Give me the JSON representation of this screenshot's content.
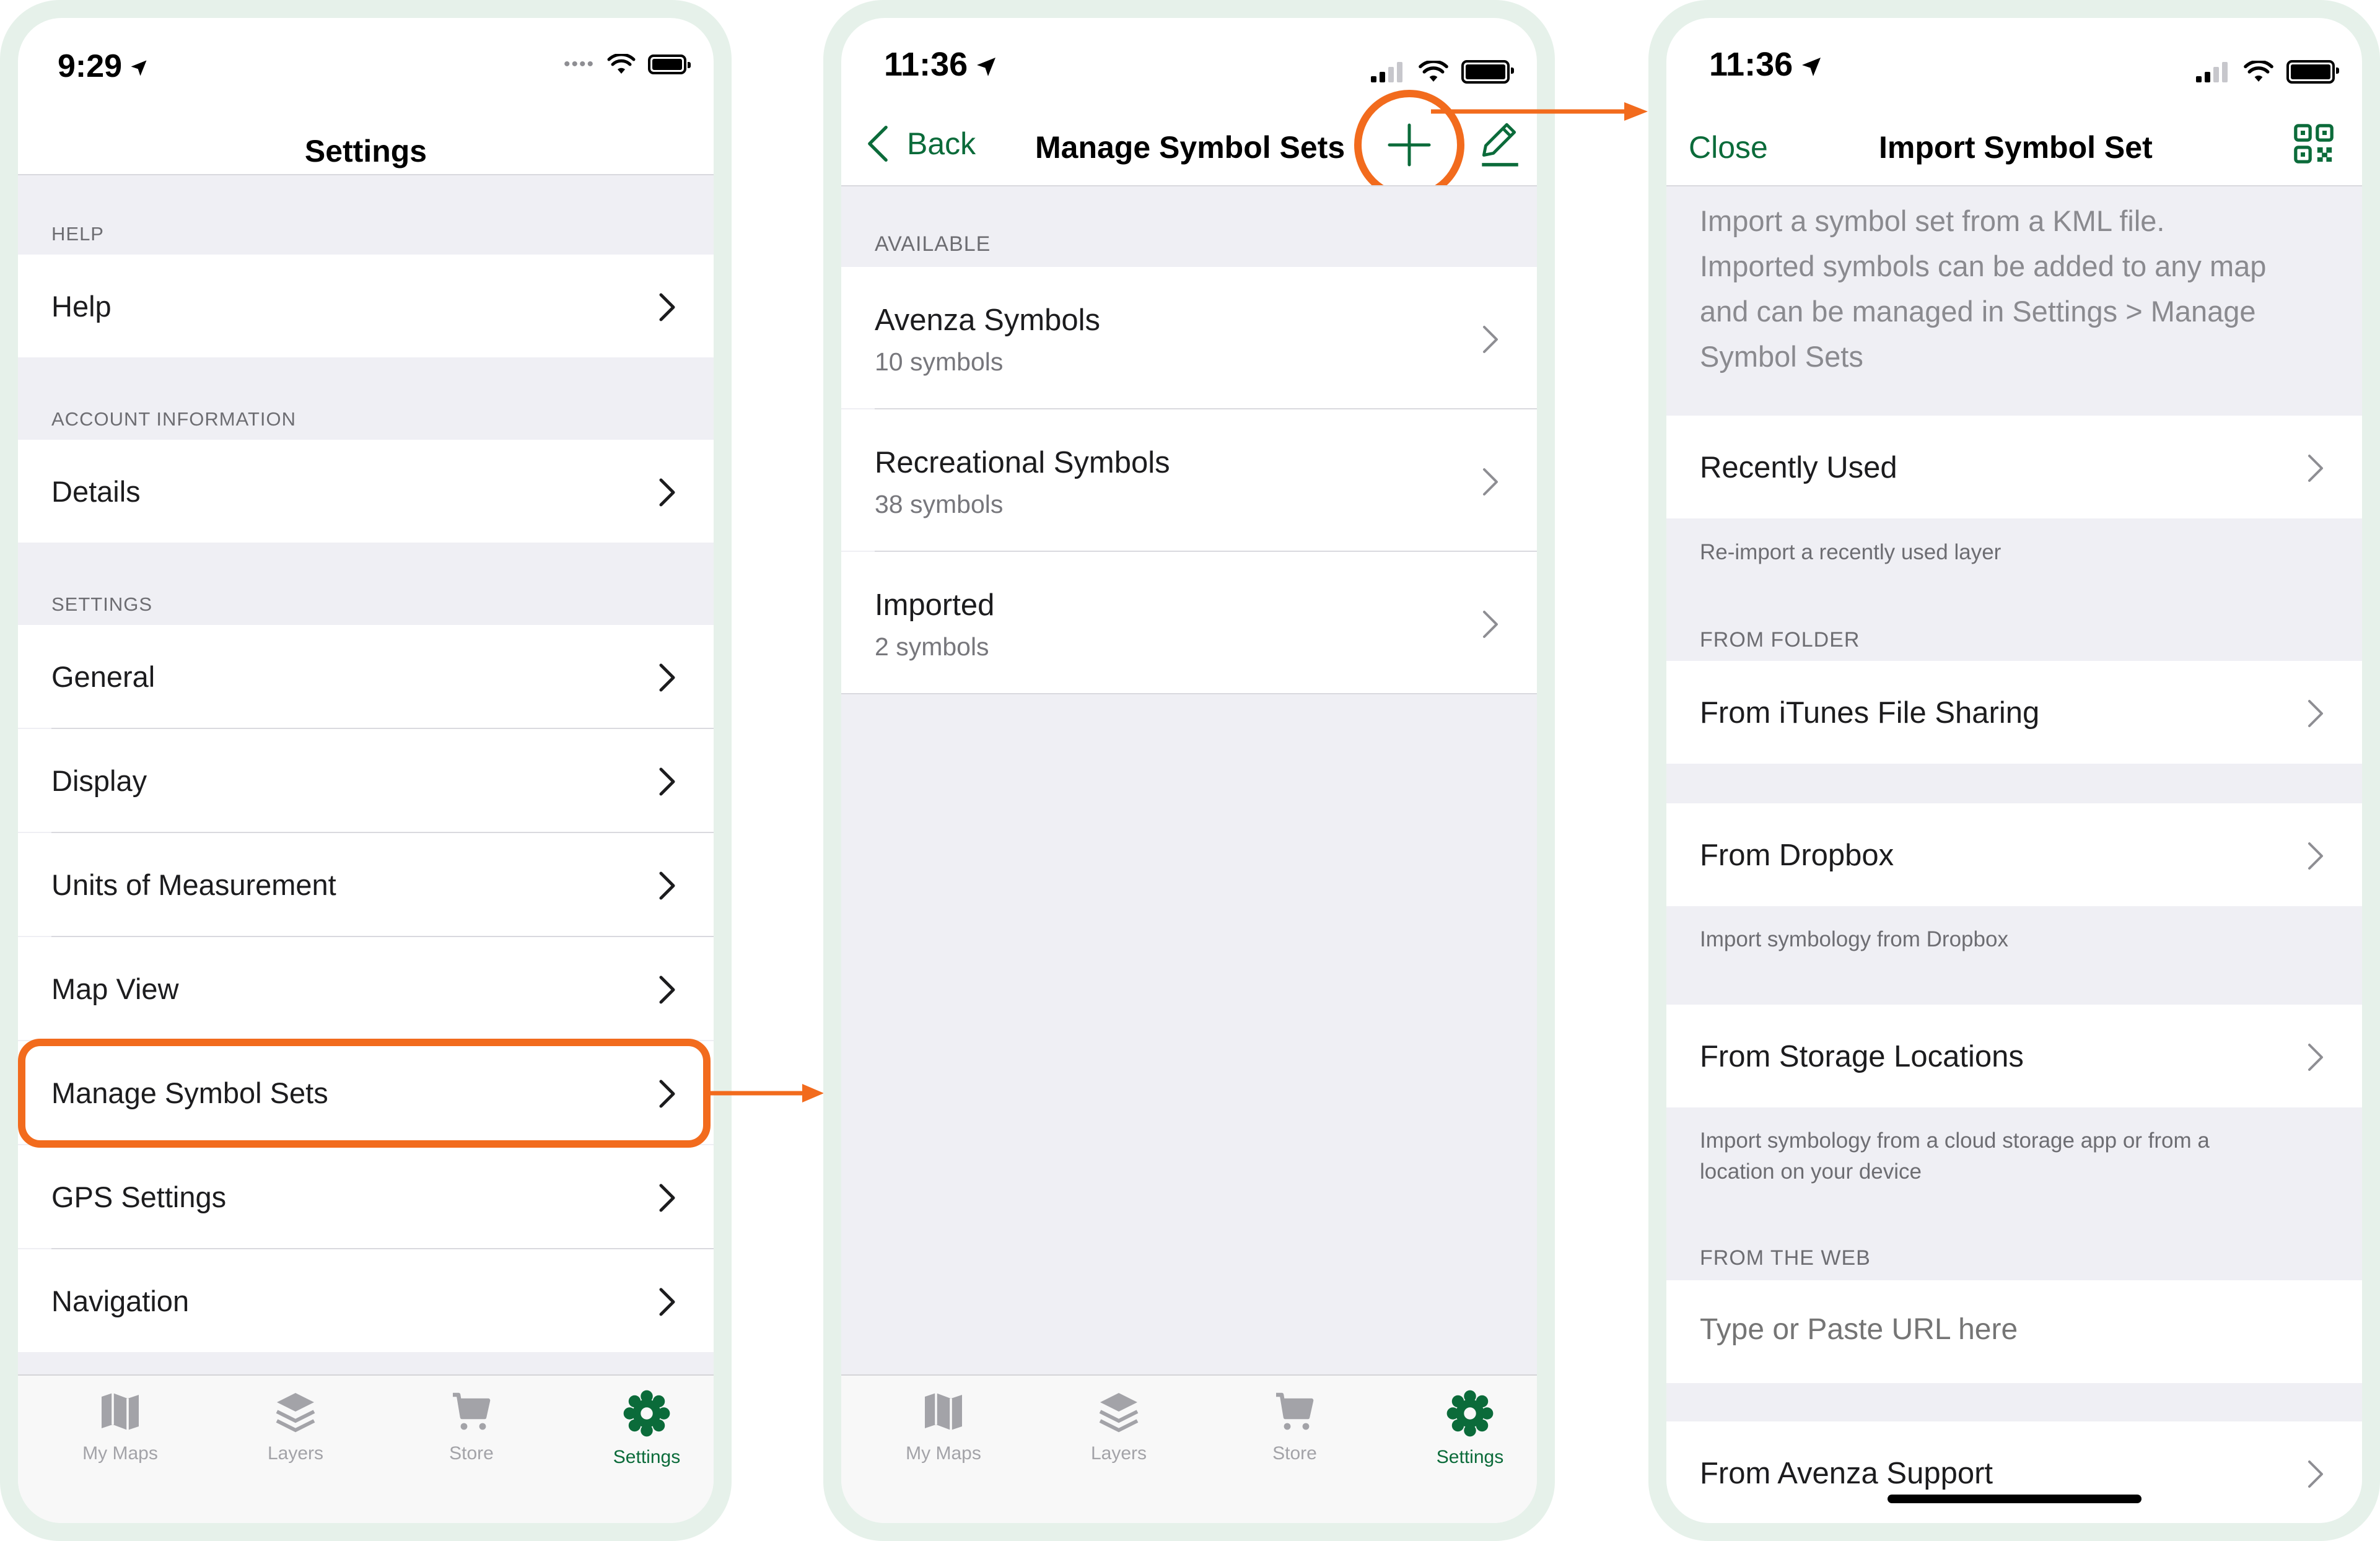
{
  "colors": {
    "accent_green": "#0b6b3a",
    "highlight_orange": "#f26b1d",
    "frame_mint": "#e6f1ea"
  },
  "screen1": {
    "time": "9:29",
    "title": "Settings",
    "sections": {
      "help": "HELP",
      "account": "ACCOUNT INFORMATION",
      "settings": "SETTINGS"
    },
    "rows": {
      "help": "Help",
      "details": "Details",
      "general": "General",
      "display": "Display",
      "units": "Units of Measurement",
      "map_view": "Map View",
      "manage_symbol_sets": "Manage Symbol Sets",
      "gps": "GPS Settings",
      "navigation": "Navigation"
    }
  },
  "screen2": {
    "time": "11:36",
    "back": "Back",
    "title": "Manage Symbol Sets",
    "section": "AVAILABLE",
    "sets": [
      {
        "name": "Avenza Symbols",
        "count": "10 symbols"
      },
      {
        "name": "Recreational Symbols",
        "count": "38 symbols"
      },
      {
        "name": "Imported",
        "count": "2 symbols"
      }
    ]
  },
  "screen3": {
    "time": "11:36",
    "close": "Close",
    "title": "Import Symbol Set",
    "description": [
      "Import a symbol set from a KML file.",
      "Imported symbols can be added to any map",
      "and can be managed in Settings > Manage",
      "Symbol Sets"
    ],
    "recently_used": "Recently Used",
    "recently_used_footer": "Re-import a recently used layer",
    "from_folder_header": "FROM FOLDER",
    "itunes": "From iTunes File Sharing",
    "dropbox": "From Dropbox",
    "dropbox_footer": "Import symbology from Dropbox",
    "storage": "From Storage Locations",
    "storage_footer": [
      "Import symbology from a cloud storage app or from a",
      "location on your device"
    ],
    "from_web_header": "FROM THE WEB",
    "url_placeholder": "Type or Paste URL here",
    "avenza_support": "From Avenza Support"
  },
  "tabs": [
    {
      "label": "My Maps",
      "icon": "map-icon"
    },
    {
      "label": "Layers",
      "icon": "layers-icon"
    },
    {
      "label": "Store",
      "icon": "cart-icon"
    },
    {
      "label": "Settings",
      "icon": "gear-icon"
    }
  ]
}
